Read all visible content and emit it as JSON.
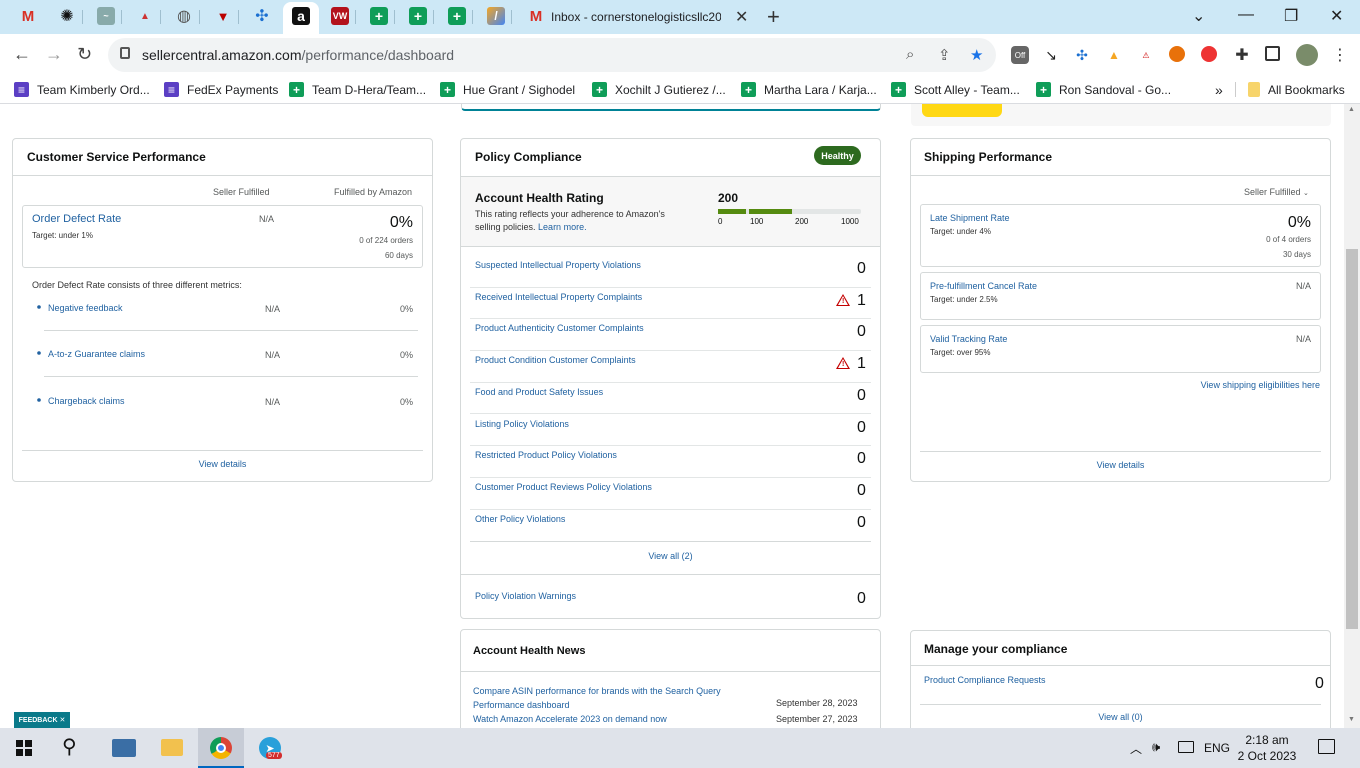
{
  "browser": {
    "active_tab_title": "Inbox - cornerstonelogisticsllc20",
    "url_domain": "sellercentral.amazon.com",
    "url_path": "/performance/dashboard",
    "bookmarks": [
      {
        "label": "Team Kimberly Ord...",
        "color": "#5b3fc4"
      },
      {
        "label": "FedEx Payments",
        "color": "#5b3fc4"
      },
      {
        "label": "Team D-Hera/Team...",
        "color": "#0f9d58"
      },
      {
        "label": "Hue Grant / Sighodel",
        "color": "#0f9d58"
      },
      {
        "label": "Xochilt J Gutierez /...",
        "color": "#0f9d58"
      },
      {
        "label": "Martha Lara / Karja...",
        "color": "#0f9d58"
      },
      {
        "label": "Scott Alley - Team...",
        "color": "#0f9d58"
      },
      {
        "label": "Ron Sandoval - Go...",
        "color": "#0f9d58"
      }
    ],
    "all_bookmarks": "All Bookmarks",
    "ext_off": "Off"
  },
  "customer_service": {
    "title": "Customer Service Performance",
    "col_seller": "Seller Fulfilled",
    "col_fba": "Fulfilled by Amazon",
    "odr_label": "Order Defect Rate",
    "odr_target": "Target: under 1%",
    "odr_seller": "N/A",
    "odr_fba": "0%",
    "odr_orders": "0 of 224 orders",
    "odr_days": "60 days",
    "consists": "Order Defect Rate consists of three different metrics:",
    "metrics": [
      {
        "label": "Negative feedback",
        "seller": "N/A",
        "fba": "0%"
      },
      {
        "label": "A-to-z Guarantee claims",
        "seller": "N/A",
        "fba": "0%"
      },
      {
        "label": "Chargeback claims",
        "seller": "N/A",
        "fba": "0%"
      }
    ],
    "view_details": "View details"
  },
  "policy": {
    "title": "Policy Compliance",
    "badge": "Healthy",
    "ahr_title": "Account Health Rating",
    "ahr_desc_1": "This rating reflects your adherence to Amazon's",
    "ahr_desc_2": "selling policies.",
    "learn_more": "Learn more.",
    "ahr_value": "200",
    "ahr_fill_fraction": 0.2,
    "scale": [
      "0",
      "100",
      "200",
      "1000"
    ],
    "rows": [
      {
        "label": "Suspected Intellectual Property Violations",
        "value": "0",
        "warn": false
      },
      {
        "label": "Received Intellectual Property Complaints",
        "value": "1",
        "warn": true
      },
      {
        "label": "Product Authenticity Customer Complaints",
        "value": "0",
        "warn": false
      },
      {
        "label": "Product Condition Customer Complaints",
        "value": "1",
        "warn": true
      },
      {
        "label": "Food and Product Safety Issues",
        "value": "0",
        "warn": false
      },
      {
        "label": "Listing Policy Violations",
        "value": "0",
        "warn": false
      },
      {
        "label": "Restricted Product Policy Violations",
        "value": "0",
        "warn": false
      },
      {
        "label": "Customer Product Reviews Policy Violations",
        "value": "0",
        "warn": false
      },
      {
        "label": "Other Policy Violations",
        "value": "0",
        "warn": false
      }
    ],
    "view_all": "View all (2)",
    "warnings_label": "Policy Violation Warnings",
    "warnings_value": "0"
  },
  "shipping": {
    "title": "Shipping Performance",
    "filter": "Seller Fulfilled",
    "late_label": "Late Shipment Rate",
    "late_target": "Target: under 4%",
    "late_value": "0%",
    "late_orders": "0 of 4 orders",
    "late_days": "30 days",
    "cancel_label": "Pre-fulfillment Cancel Rate",
    "cancel_target": "Target: under 2.5%",
    "cancel_value": "N/A",
    "tracking_label": "Valid Tracking Rate",
    "tracking_target": "Target: over 95%",
    "tracking_value": "N/A",
    "eligibilities": "View shipping eligibilities here",
    "view_details": "View details"
  },
  "news": {
    "title": "Account Health News",
    "items": [
      {
        "line1": "Compare ASIN performance for brands with the Search Query",
        "line2": "Performance dashboard",
        "date": "September 28, 2023"
      },
      {
        "line1": "Watch Amazon Accelerate 2023 on demand now",
        "line2": "",
        "date": "September 27, 2023"
      }
    ]
  },
  "compliance": {
    "title": "Manage your compliance",
    "requests_label": "Product Compliance Requests",
    "requests_value": "0",
    "view_all": "View all (0)"
  },
  "feedback": "FEEDBACK",
  "taskbar": {
    "lang": "ENG",
    "time": "2:18 am",
    "date": "2 Oct 2023",
    "badge": "577"
  }
}
